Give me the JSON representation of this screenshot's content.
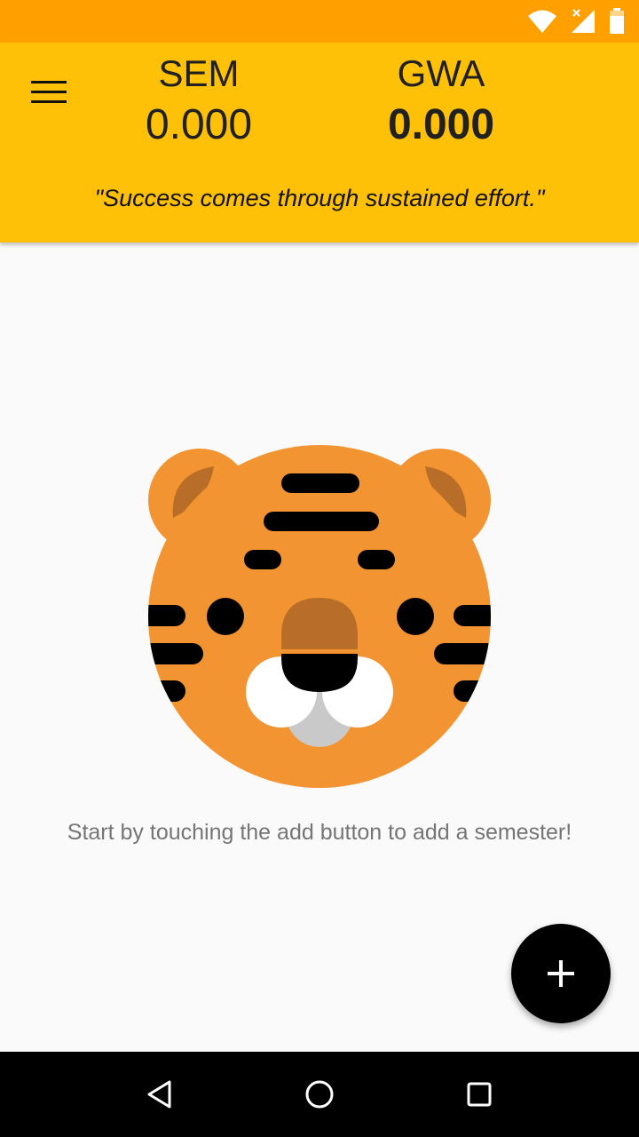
{
  "status_bar": {
    "icons": [
      "wifi-icon",
      "signal-icon",
      "battery-icon"
    ],
    "color": "#ffa000"
  },
  "header": {
    "background": "#ffc107",
    "menu_icon": "menu-icon",
    "sem": {
      "label": "SEM",
      "value": "0.000"
    },
    "gwa": {
      "label": "GWA",
      "value": "0.000"
    },
    "quote": "\"Success comes through sustained effort.\""
  },
  "main": {
    "mascot_icon": "tiger-icon",
    "empty_message": "Start by touching the add button to add a semester!",
    "fab": {
      "icon": "plus-icon",
      "label": "+"
    }
  },
  "nav_bar": {
    "buttons": [
      "back-icon",
      "home-icon",
      "recents-icon"
    ]
  }
}
